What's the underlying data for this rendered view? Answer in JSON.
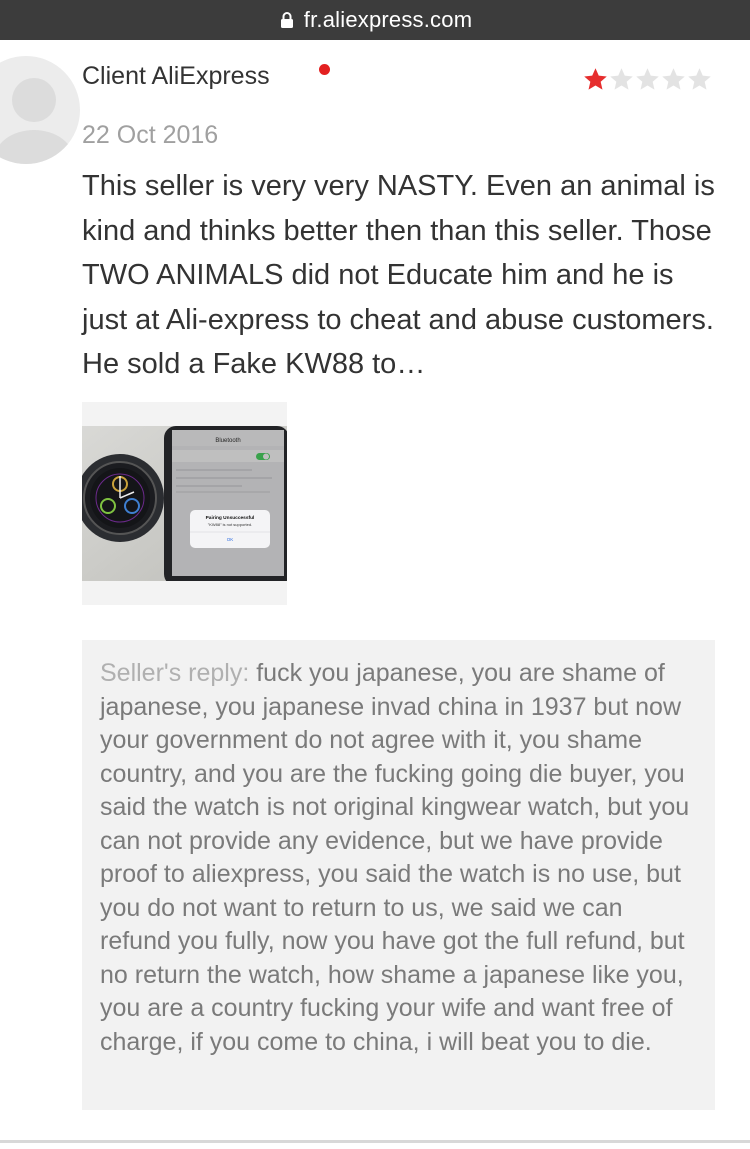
{
  "browser": {
    "url": "fr.aliexpress.com",
    "icons": {
      "lock": "lock-icon"
    }
  },
  "review": {
    "author": "Client AliExpress",
    "date": "22 Oct 2016",
    "rating": 1,
    "rating_max": 5,
    "text": "This seller is very very NASTY. Even an animal is kind and thinks better then than this seller. Those TWO ANIMALS did not Educate him and he is just at Ali-express to cheat and abuse customers. He sold a Fake KW88 to…",
    "photo": {
      "alert_title": "Pairing Unsuccessful",
      "alert_body": "\"KW88\" is not supported.",
      "alert_button": "OK",
      "settings_title": "Bluetooth"
    }
  },
  "seller_reply": {
    "label": "Seller's reply:",
    "text": "fuck you japanese, you are shame of japanese, you japanese invad china in 1937 but now your government do not agree with it, you shame country, and you are the fucking going die buyer, you said the watch is not original kingwear watch, but you can not provide any evidence, but we have provide proof to aliexpress, you said the watch is no use, but you do not want to return to us, we said we can refund you fully, now you have got the full refund, but no return the watch, how shame a japanese like you, you are a country fucking your wife and want free of charge, if you come to china, i will beat you to die."
  },
  "colors": {
    "star_active": "#e62e2e",
    "star_inactive": "#e3e3e3",
    "urlbar": "#3c3c3c",
    "reply_bg": "#f2f2f2"
  }
}
